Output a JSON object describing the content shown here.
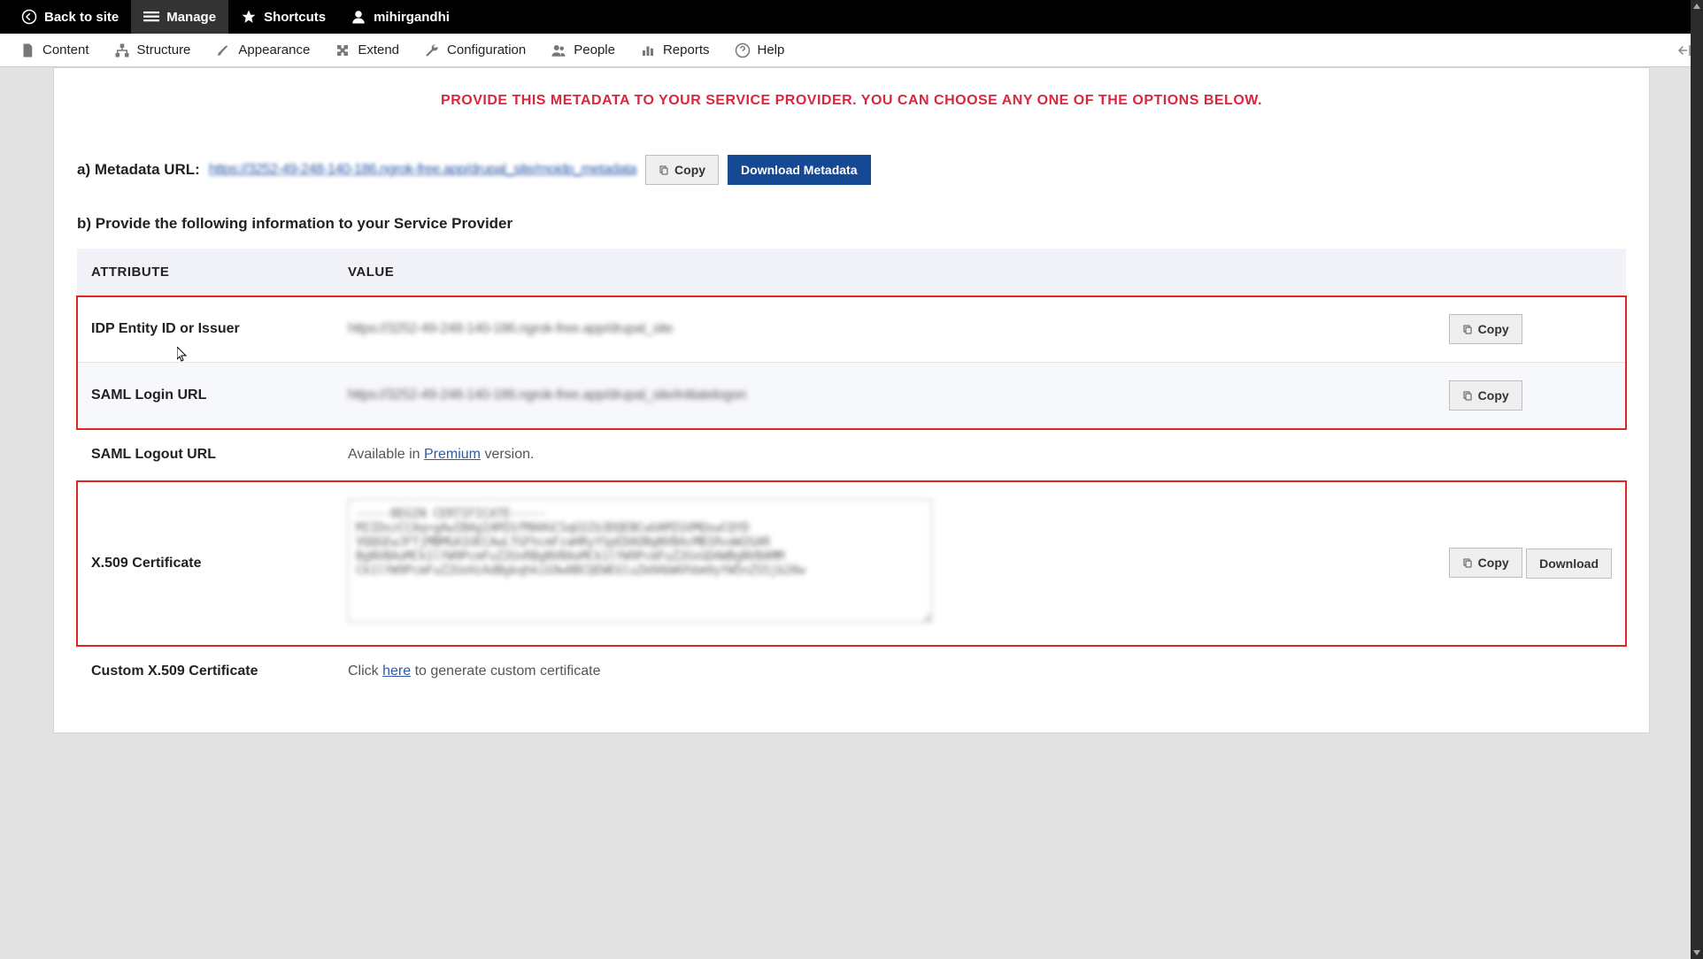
{
  "topbar": {
    "back": "Back to site",
    "manage": "Manage",
    "shortcuts": "Shortcuts",
    "user": "mihirgandhi"
  },
  "adminbar": {
    "content": "Content",
    "structure": "Structure",
    "appearance": "Appearance",
    "extend": "Extend",
    "configuration": "Configuration",
    "people": "People",
    "reports": "Reports",
    "help": "Help"
  },
  "banner": "PROVIDE THIS METADATA TO YOUR SERVICE PROVIDER. YOU CAN CHOOSE ANY ONE OF THE OPTIONS BELOW.",
  "section_a": {
    "label": "a) Metadata URL:",
    "url": "https://3252-49-248-140-186.ngrok-free.app/drupal_site/moidp_metadata",
    "copy": "Copy",
    "download": "Download Metadata"
  },
  "section_b": {
    "heading": "b) Provide the following information to your Service Provider"
  },
  "table": {
    "head_attr": "ATTRIBUTE",
    "head_value": "VALUE",
    "rows": {
      "idp": {
        "name": "IDP Entity ID or Issuer",
        "value": "https://3252-49-248-140-186.ngrok-free.app/drupal_site"
      },
      "login": {
        "name": "SAML Login URL",
        "value": "https://3252-49-248-140-186.ngrok-free.app/drupal_site/initiatelogon"
      },
      "logout": {
        "name": "SAML Logout URL",
        "value_prefix": "Available in ",
        "premium": "Premium",
        "value_suffix": " version."
      },
      "cert": {
        "name": "X.509 Certificate",
        "value": "-----BEGIN CERTIFICATE-----\nMIIDxzCCAq+gAwIBAgIAMIGfMA0GCSqGSIb3DQEBCwUAMIGVMQswCQYD\nVQQGEwJFTjMBMGA1UECAwLTGFhcmFzaHRyYSpEDAOBgNVBAcMB1RvaW2GAR\nBgNVBAoMCk1lYW9PcmFuZ2UxRBgNVBAoMCk1lYW9PcmFuZ2UxGDAWBgNVBAMM\nCk1lYW9PcmFuZ2UxHzAdBgkqhkiG9w0BCQEWEGluZm9AbWVhbm9yYW5nZS5jb20w",
        "download": "Download"
      },
      "custom": {
        "name": "Custom X.509 Certificate",
        "prefix": "Click ",
        "here": "here",
        "suffix": " to generate custom certificate"
      }
    },
    "copy_btn": "Copy"
  }
}
